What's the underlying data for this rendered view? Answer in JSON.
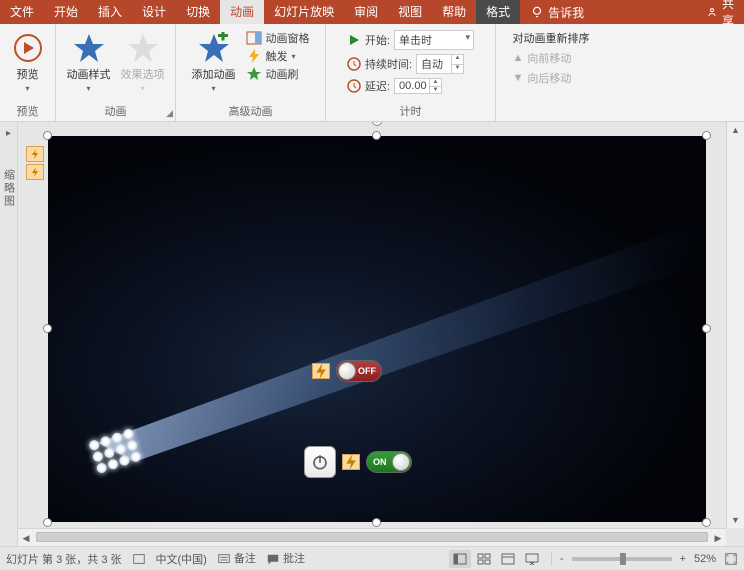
{
  "tabs": {
    "file": "文件",
    "home": "开始",
    "insert": "插入",
    "design": "设计",
    "transitions": "切换",
    "animations": "动画",
    "slideshow": "幻灯片放映",
    "review": "审阅",
    "view": "视图",
    "help": "帮助",
    "format": "格式",
    "tellme": "告诉我",
    "share": "共享"
  },
  "ribbon": {
    "preview": {
      "label": "预览",
      "group": "预览"
    },
    "animation": {
      "styles": "动画样式",
      "effect_options": "效果选项",
      "group": "动画"
    },
    "advanced": {
      "add": "添加动画",
      "pane": "动画窗格",
      "trigger": "触发",
      "painter": "动画刷",
      "group": "高级动画"
    },
    "timing": {
      "start_label": "开始:",
      "start_value": "单击时",
      "duration_label": "持续时间:",
      "duration_value": "自动",
      "delay_label": "延迟:",
      "delay_value": "00.00",
      "group": "计时"
    },
    "reorder": {
      "title": "对动画重新排序",
      "earlier": "向前移动",
      "later": "向后移动"
    }
  },
  "sidepanel": {
    "label": "缩略图"
  },
  "slide": {
    "off_label": "OFF",
    "on_label": "ON"
  },
  "statusbar": {
    "slide_info": "幻灯片 第 3 张，共 3 张",
    "lang": "中文(中国)",
    "notes": "备注",
    "comments": "批注",
    "zoom": "52%",
    "zoom_minus": "-",
    "zoom_plus": "+"
  }
}
